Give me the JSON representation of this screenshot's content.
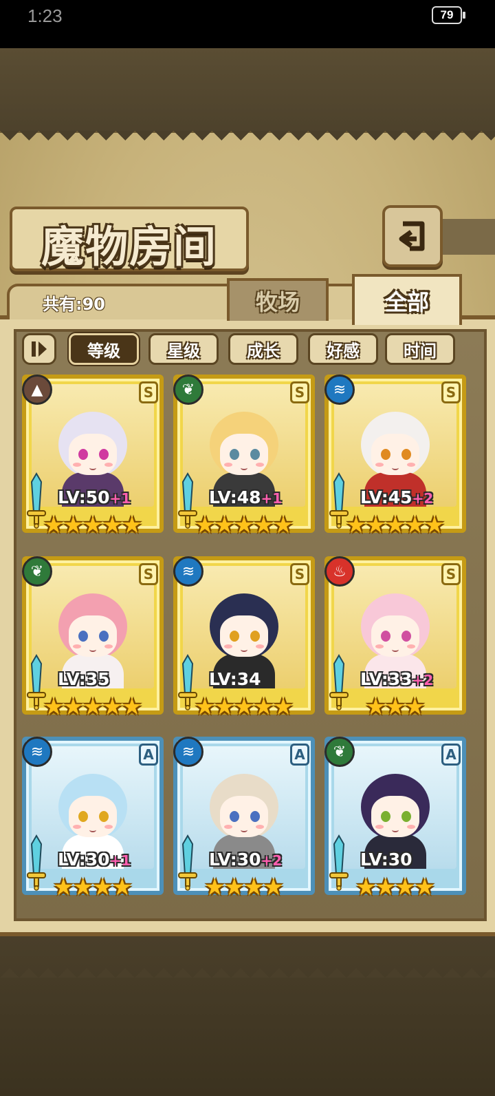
{
  "status_bar": {
    "time": "1:23",
    "battery": "79"
  },
  "header": {
    "title": "魔物房间"
  },
  "summary": {
    "count_label": "共有:90"
  },
  "tabs": [
    {
      "label": "牧场",
      "active": false
    },
    {
      "label": "全部",
      "active": true
    }
  ],
  "sort": {
    "buttons": [
      {
        "label": "等级",
        "selected": true
      },
      {
        "label": "星级",
        "selected": false
      },
      {
        "label": "成长",
        "selected": false
      },
      {
        "label": "好感",
        "selected": false
      },
      {
        "label": "时间",
        "selected": false
      }
    ]
  },
  "colors": {
    "earth": "#6b4a3a",
    "leaf": "#2f7a3a",
    "water": "#1f78c0",
    "fire": "#d8322a",
    "gold_frame": "#f1d64a",
    "blue_frame": "#a9d8ea",
    "bonus": "#ff5fb0"
  },
  "monsters": [
    {
      "element": "earth",
      "element_icon": "mountain-icon",
      "rank": "S",
      "level": "LV:50",
      "bonus": "+1",
      "stars": 5,
      "frame": "gold",
      "hair": "#e6e2f2",
      "outfit": "#5a3a6a",
      "eyes": "#d03aa0"
    },
    {
      "element": "leaf",
      "element_icon": "leaf-icon",
      "rank": "S",
      "level": "LV:48",
      "bonus": "+1",
      "stars": 5,
      "frame": "gold",
      "hair": "#f5d27a",
      "outfit": "#3a3a3a",
      "eyes": "#5a8aa0"
    },
    {
      "element": "water",
      "element_icon": "water-icon",
      "rank": "S",
      "level": "LV:45",
      "bonus": "+2",
      "stars": 5,
      "frame": "gold",
      "hair": "#f3f0ee",
      "outfit": "#c0302a",
      "eyes": "#e08a20"
    },
    {
      "element": "leaf",
      "element_icon": "leaf-icon",
      "rank": "S",
      "level": "LV:35",
      "bonus": "",
      "stars": 5,
      "frame": "gold",
      "hair": "#f3a0b0",
      "outfit": "#f6f0f0",
      "eyes": "#4a70c0"
    },
    {
      "element": "water",
      "element_icon": "water-icon",
      "rank": "S",
      "level": "LV:34",
      "bonus": "",
      "stars": 5,
      "frame": "gold",
      "hair": "#2a2f52",
      "outfit": "#2a2a2a",
      "eyes": "#e0a020"
    },
    {
      "element": "fire",
      "element_icon": "fire-icon",
      "rank": "S",
      "level": "LV:33",
      "bonus": "+2",
      "stars": 3,
      "frame": "gold",
      "hair": "#f8c8d8",
      "outfit": "#fbe6ea",
      "eyes": "#d050a0"
    },
    {
      "element": "water",
      "element_icon": "water-icon",
      "rank": "A",
      "level": "LV:30",
      "bonus": "+1",
      "stars": 4,
      "frame": "blue",
      "hair": "#b8e0f4",
      "outfit": "#ffffff",
      "eyes": "#e0a820"
    },
    {
      "element": "water",
      "element_icon": "water-icon",
      "rank": "A",
      "level": "LV:30",
      "bonus": "+2",
      "stars": 4,
      "frame": "blue",
      "hair": "#e8dcc8",
      "outfit": "#8a8a8a",
      "eyes": "#4a70c0"
    },
    {
      "element": "leaf",
      "element_icon": "leaf-icon",
      "rank": "A",
      "level": "LV:30",
      "bonus": "",
      "stars": 4,
      "frame": "blue",
      "hair": "#3a2a5a",
      "outfit": "#2a2a3a",
      "eyes": "#7ab030"
    }
  ]
}
